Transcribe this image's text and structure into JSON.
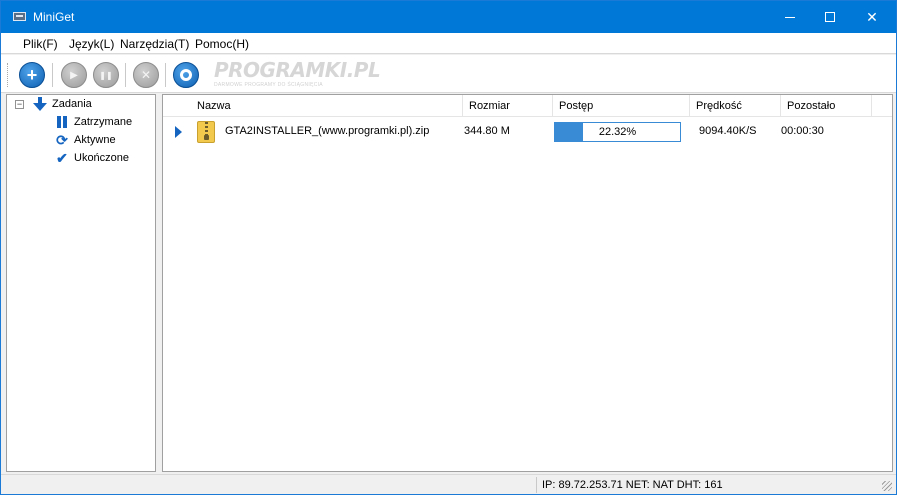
{
  "window": {
    "title": "MiniGet",
    "minimize_icon": "minimize-icon",
    "maximize_icon": "maximize-icon",
    "close_glyph": "✕"
  },
  "menu": [
    "Plik(F)",
    "Język(L)",
    "Narzędzia(T)",
    "Pomoc(H)"
  ],
  "toolbar": {
    "buttons": [
      {
        "name": "add",
        "icon": "plus-icon",
        "glyph": "+"
      },
      {
        "name": "start",
        "icon": "play-icon",
        "glyph": "▶"
      },
      {
        "name": "pause",
        "icon": "pause-icon",
        "glyph": "❚❚"
      },
      {
        "name": "stop",
        "icon": "close-icon",
        "glyph": "✕"
      },
      {
        "name": "settings",
        "icon": "gear-icon",
        "glyph": ""
      }
    ],
    "watermark_title": "PROGRAMKI.PL",
    "watermark_sub": "DARMOWE PROGRAMY DO ŚCIĄGNIĘCIA"
  },
  "tree": {
    "root": {
      "label": "Zadania",
      "icon": "download-arrow-icon",
      "expander": "⊟"
    },
    "children": [
      {
        "label": "Zatrzymane",
        "icon": "pause-icon"
      },
      {
        "label": "Aktywne",
        "icon": "sync-icon",
        "glyph": "⟳"
      },
      {
        "label": "Ukończone",
        "icon": "checkmark-icon",
        "glyph": "✔"
      }
    ]
  },
  "list": {
    "columns": [
      "Nazwa",
      "Rozmiar",
      "Postęp",
      "Prędkość",
      "Pozostało"
    ],
    "rows": [
      {
        "name": "GTA2INSTALLER_(www.programki.pl).zip",
        "size": "344.80 M",
        "progress": 22.32,
        "progress_text": "22.32%",
        "speed": "9094.40K/S",
        "remaining": "00:00:30"
      }
    ]
  },
  "status": {
    "text": "IP: 89.72.253.71 NET: NAT  DHT: 161"
  },
  "colors": {
    "titlebar": "#0078d7",
    "accent": "#1565c0",
    "progress": "#3a8bd6"
  }
}
